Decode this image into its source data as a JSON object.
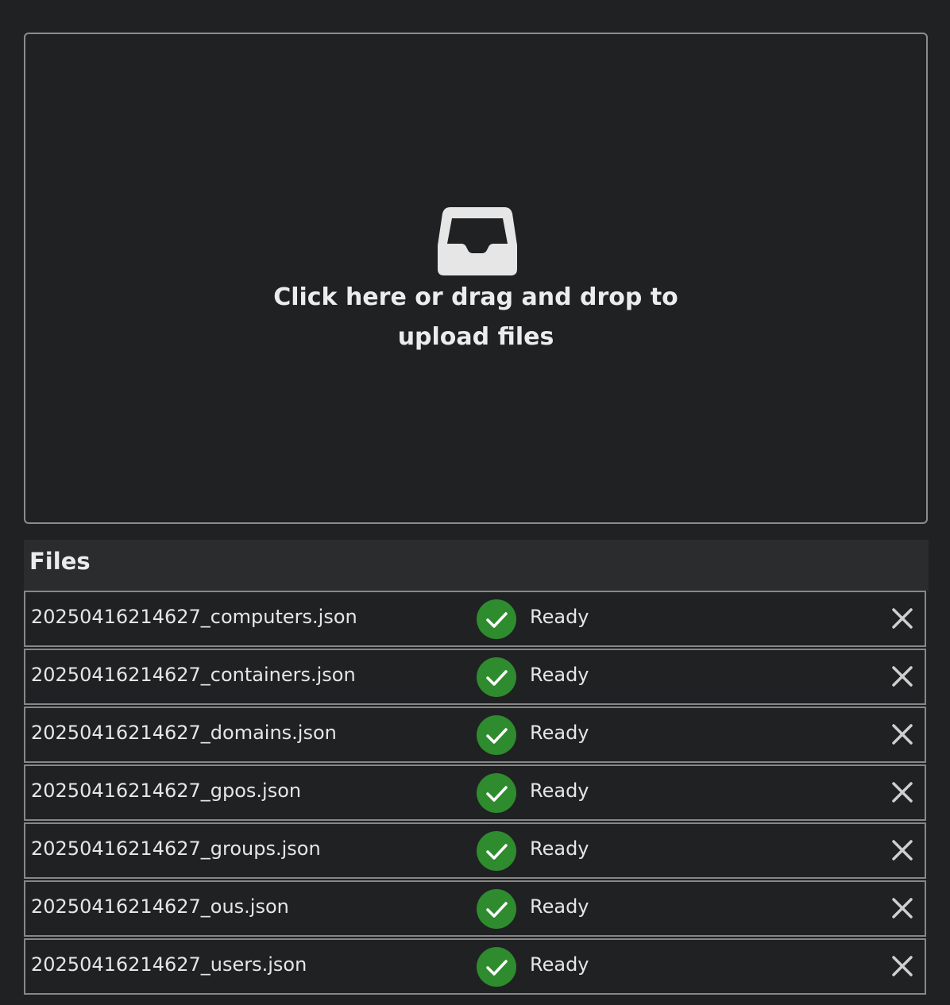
{
  "dropzone": {
    "icon": "inbox-icon",
    "text": "Click here or drag and drop to upload files"
  },
  "files": {
    "title": "Files",
    "status_icon": "check-circle-icon",
    "remove_icon": "close-icon",
    "colors": {
      "ready_status": "#2e8b2e",
      "background": "#202123"
    },
    "items": [
      {
        "name": "20250416214627_computers.json",
        "status": "Ready"
      },
      {
        "name": "20250416214627_containers.json",
        "status": "Ready"
      },
      {
        "name": "20250416214627_domains.json",
        "status": "Ready"
      },
      {
        "name": "20250416214627_gpos.json",
        "status": "Ready"
      },
      {
        "name": "20250416214627_groups.json",
        "status": "Ready"
      },
      {
        "name": "20250416214627_ous.json",
        "status": "Ready"
      },
      {
        "name": "20250416214627_users.json",
        "status": "Ready"
      }
    ]
  }
}
